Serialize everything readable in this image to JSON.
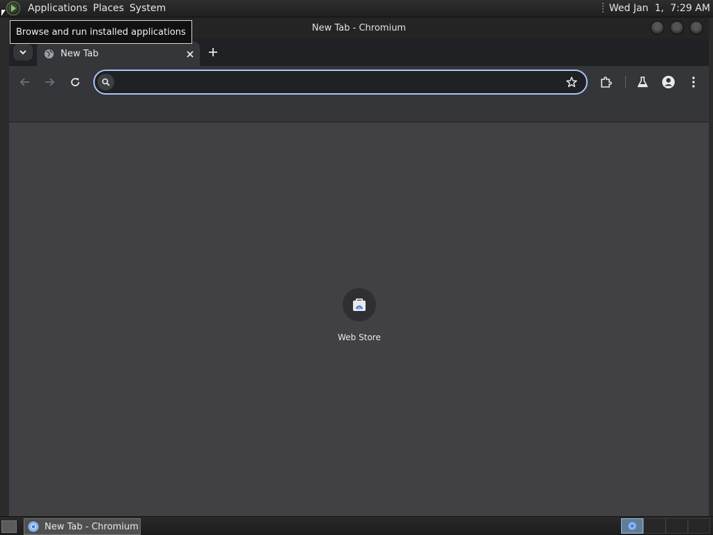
{
  "top_panel": {
    "menus": [
      "Applications",
      "Places",
      "System"
    ],
    "clock": "Wed Jan  1,  7:29 AM",
    "tooltip": "Browse and run installed applications",
    "icon": "app-menu-icon"
  },
  "window": {
    "title": "New Tab - Chromium"
  },
  "tabs": [
    {
      "title": "New Tab",
      "icon": "globe-icon"
    }
  ],
  "toolbar": {
    "omnibox_value": "",
    "icons": [
      "back-arrow-icon",
      "forward-arrow-icon",
      "reload-icon",
      "bookmark-star-icon",
      "extensions-icon",
      "labs-flask-icon",
      "profile-icon",
      "menu-dots-icon"
    ]
  },
  "new_tab_page": {
    "shortcuts": [
      {
        "title": "Web Store",
        "icon": "web-store-icon"
      }
    ]
  },
  "taskbar": {
    "tasks": [
      {
        "label": "New Tab - Chromium",
        "icon": "chromium-icon"
      }
    ],
    "workspace_count": 4,
    "active_workspace": 1
  },
  "colors": {
    "accent": "#a8c7fa",
    "content_bg": "#414045",
    "toolbar_bg": "#35363a",
    "tabstrip_bg": "#202124"
  }
}
